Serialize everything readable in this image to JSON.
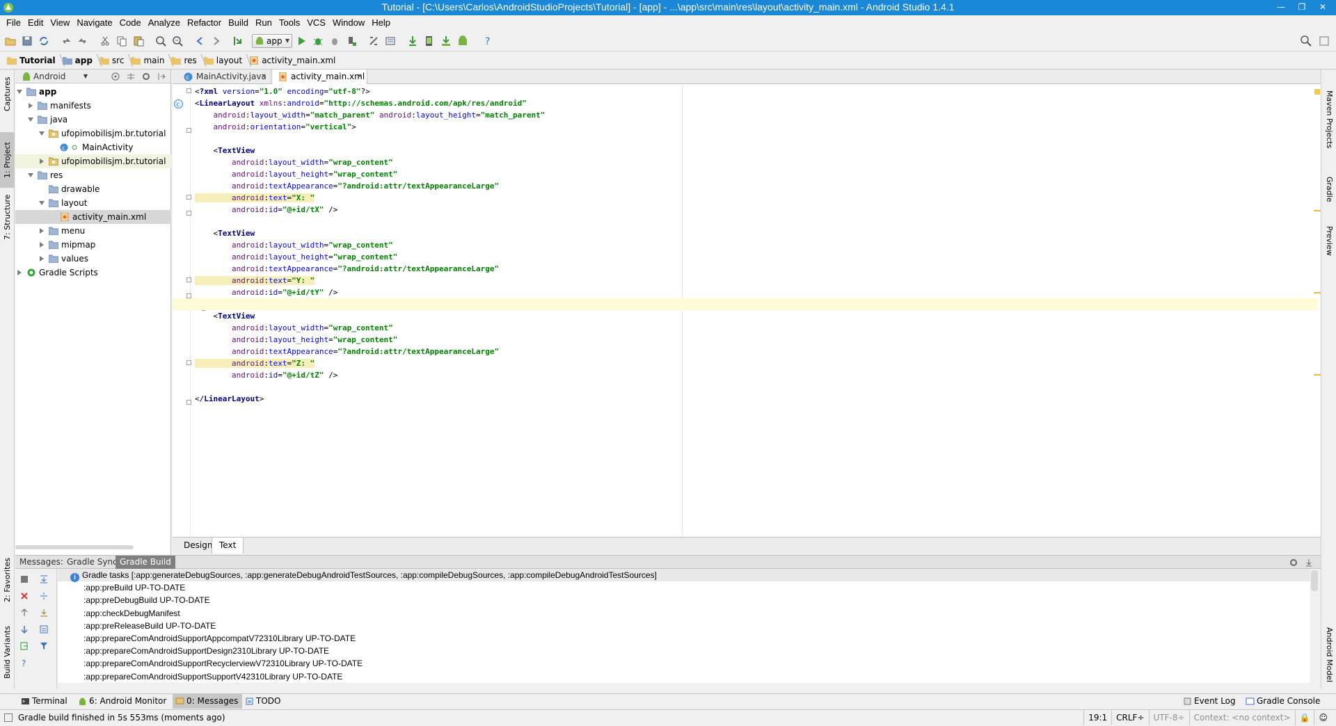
{
  "window": {
    "title": "Tutorial - [C:\\Users\\Carlos\\AndroidStudioProjects\\Tutorial] - [app] - ...\\app\\src\\main\\res\\layout\\activity_main.xml - Android Studio 1.4.1",
    "minimize": "—",
    "maximize": "❐",
    "close": "✕"
  },
  "menu": [
    "File",
    "Edit",
    "View",
    "Navigate",
    "Code",
    "Analyze",
    "Refactor",
    "Build",
    "Run",
    "Tools",
    "VCS",
    "Window",
    "Help"
  ],
  "toolbar": {
    "run_config": "app"
  },
  "breadcrumb": [
    "Tutorial",
    "app",
    "src",
    "main",
    "res",
    "layout",
    "activity_main.xml"
  ],
  "project": {
    "view_mode": "Android",
    "tree": [
      {
        "label": "app",
        "level": 0,
        "arrow": "open",
        "icon": "folder",
        "bold": true
      },
      {
        "label": "manifests",
        "level": 1,
        "arrow": "closed",
        "icon": "folder"
      },
      {
        "label": "java",
        "level": 1,
        "arrow": "open",
        "icon": "folder"
      },
      {
        "label": "ufopimobilisjm.br.tutorial",
        "level": 2,
        "arrow": "open",
        "icon": "package"
      },
      {
        "label": "MainActivity",
        "level": 3,
        "arrow": "none",
        "icon": "class"
      },
      {
        "label": "ufopimobilisjm.br.tutorial",
        "level": 2,
        "arrow": "closed",
        "icon": "package",
        "hl": true
      },
      {
        "label": "res",
        "level": 1,
        "arrow": "open",
        "icon": "folder"
      },
      {
        "label": "drawable",
        "level": 2,
        "arrow": "none",
        "icon": "folder"
      },
      {
        "label": "layout",
        "level": 2,
        "arrow": "open",
        "icon": "folder"
      },
      {
        "label": "activity_main.xml",
        "level": 3,
        "arrow": "none",
        "icon": "xml",
        "selected": true
      },
      {
        "label": "menu",
        "level": 2,
        "arrow": "closed",
        "icon": "folder"
      },
      {
        "label": "mipmap",
        "level": 2,
        "arrow": "closed",
        "icon": "folder"
      },
      {
        "label": "values",
        "level": 2,
        "arrow": "closed",
        "icon": "folder"
      },
      {
        "label": "Gradle Scripts",
        "level": 0,
        "arrow": "closed",
        "icon": "gradle"
      }
    ]
  },
  "left_strip": [
    "1: Project",
    "Captures",
    "7: Structure",
    "2: Favorites",
    "Build Variants"
  ],
  "right_strip": [
    "Maven Projects",
    "Gradle",
    "Preview",
    "Android Model"
  ],
  "editor": {
    "tabs": [
      {
        "label": "MainActivity.java",
        "active": false
      },
      {
        "label": "activity_main.xml",
        "active": true
      }
    ],
    "bottom_tabs": [
      "Design",
      "Text"
    ],
    "lines": [
      "<?xml version=\"1.0\" encoding=\"utf-8\"?>",
      "<LinearLayout xmlns:android=\"http://schemas.android.com/apk/res/android\"",
      "    android:layout_width=\"match_parent\" android:layout_height=\"match_parent\"",
      "    android:orientation=\"vertical\">",
      "",
      "    <TextView",
      "        android:layout_width=\"wrap_content\"",
      "        android:layout_height=\"wrap_content\"",
      "        android:textAppearance=\"?android:attr/textAppearanceLarge\"",
      "        android:text=\"X: \"",
      "        android:id=\"@+id/tX\" />",
      "",
      "    <TextView",
      "        android:layout_width=\"wrap_content\"",
      "        android:layout_height=\"wrap_content\"",
      "        android:textAppearance=\"?android:attr/textAppearanceLarge\"",
      "        android:text=\"Y: \"",
      "        android:id=\"@+id/tY\" />",
      "",
      "    <TextView",
      "        android:layout_width=\"wrap_content\"",
      "        android:layout_height=\"wrap_content\"",
      "        android:textAppearance=\"?android:attr/textAppearanceLarge\"",
      "        android:text=\"Z: \"",
      "        android:id=\"@+id/tZ\" />",
      "",
      "</LinearLayout>"
    ]
  },
  "messages": {
    "tabs": [
      "Messages:",
      "Gradle Sync",
      "Gradle Build"
    ],
    "lines": [
      "Gradle tasks [:app:generateDebugSources, :app:generateDebugAndroidTestSources, :app:compileDebugSources, :app:compileDebugAndroidTestSources]",
      ":app:preBuild UP-TO-DATE",
      ":app:preDebugBuild UP-TO-DATE",
      ":app:checkDebugManifest",
      ":app:preReleaseBuild UP-TO-DATE",
      ":app:prepareComAndroidSupportAppcompatV72310Library UP-TO-DATE",
      ":app:prepareComAndroidSupportDesign2310Library UP-TO-DATE",
      ":app:prepareComAndroidSupportRecyclerviewV72310Library UP-TO-DATE",
      ":app:prepareComAndroidSupportSupportV42310Library UP-TO-DATE"
    ]
  },
  "toolwindows": [
    {
      "label": "Terminal",
      "active": false
    },
    {
      "label": "6: Android Monitor",
      "active": false
    },
    {
      "label": "0: Messages",
      "active": true
    },
    {
      "label": "TODO",
      "active": false
    },
    {
      "label": "Event Log",
      "active": false
    },
    {
      "label": "Gradle Console",
      "active": false
    }
  ],
  "status": {
    "message": "Gradle build finished in 5s 553ms (moments ago)",
    "position": "19:1",
    "line_sep": "CRLF÷",
    "encoding": "UTF-8÷",
    "context": "Context: <no context>"
  },
  "colors": {
    "titlebar": "#1a87d7",
    "xml_tag": "#000080",
    "xml_attr": "#0000ff",
    "xml_string": "#008000"
  }
}
